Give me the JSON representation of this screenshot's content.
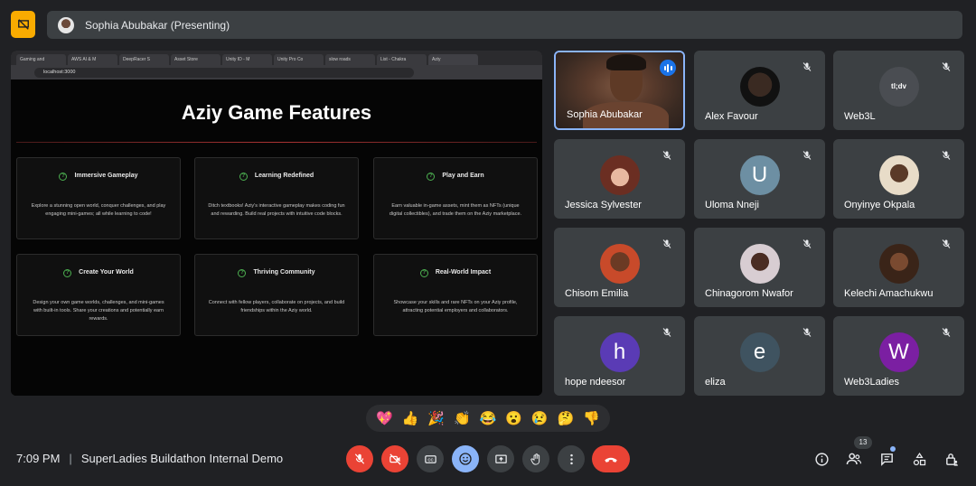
{
  "topbar": {
    "presenting_label": "Sophia Abubakar (Presenting)"
  },
  "shared_screen": {
    "browser_tabs": [
      "Gaming and",
      "AWS AI & M",
      "DeepRacer S",
      "Asset Store",
      "Unity ID - M",
      "Unity Pro Co",
      "slow roads",
      "List - Chakra",
      "Aziy"
    ],
    "url": "localhost:3000",
    "page_title": "Aziy Game Features",
    "cards": [
      {
        "title": "Immersive Gameplay",
        "desc": "Explore a stunning open world, conquer challenges, and play engaging mini-games; all while learning to code!"
      },
      {
        "title": "Learning Redefined",
        "desc": "Ditch textbooks! Aziy's interactive gameplay makes coding fun and rewarding. Build real projects with intuitive code blocks."
      },
      {
        "title": "Play and Earn",
        "desc": "Earn valuable in-game assets, mint them as NFTs (unique digital collectibles), and trade them on the Aziy marketplace."
      },
      {
        "title": "Create Your World",
        "desc": "Design your own game worlds, challenges, and mini-games with built-in tools. Share your creations and potentially earn rewards."
      },
      {
        "title": "Thriving Community",
        "desc": "Connect with fellow players, collaborate on projects, and build friendships within the Aziy world."
      },
      {
        "title": "Real-World Impact",
        "desc": "Showcase your skills and rare NFTs on your Aziy profile, attracting potential employers and collaborators."
      }
    ]
  },
  "participants": [
    {
      "name": "Sophia Abubakar",
      "type": "video",
      "speaking": true
    },
    {
      "name": "Alex Favour",
      "type": "photo",
      "color": "#1a1a1a"
    },
    {
      "name": "Web3L",
      "type": "logo",
      "logo_text": "tl;dv"
    },
    {
      "name": "Jessica Sylvester",
      "type": "photo",
      "color": "#8a4b3a"
    },
    {
      "name": "Uloma Nneji",
      "type": "letter",
      "letter": "U",
      "color": "#6d8fa3"
    },
    {
      "name": "Onyinye Okpala",
      "type": "photo",
      "color": "#e8dcc8"
    },
    {
      "name": "Chisom Emilia",
      "type": "photo",
      "color": "#c84a2a"
    },
    {
      "name": "Chinagorom Nwafor",
      "type": "photo",
      "color": "#d8cdd2"
    },
    {
      "name": "Kelechi Amachukwu",
      "type": "photo",
      "color": "#3a2418"
    },
    {
      "name": "hope ndeesor",
      "type": "letter",
      "letter": "h",
      "color": "#5a3bb5"
    },
    {
      "name": "eliza",
      "type": "letter",
      "letter": "e",
      "color": "#3f5360"
    },
    {
      "name": "Web3Ladies",
      "type": "letter",
      "letter": "W",
      "color": "#7b1fa2"
    }
  ],
  "reactions": [
    "💖",
    "👍",
    "🎉",
    "👏",
    "😂",
    "😮",
    "😢",
    "🤔",
    "👎"
  ],
  "footer": {
    "time": "7:09 PM",
    "separator": "|",
    "meeting_title": "SuperLadies Buildathon Internal Demo",
    "participant_count": "13"
  },
  "colors": {
    "accent_blue": "#8ab4f8",
    "danger_red": "#ea4335",
    "bg": "#202124",
    "tile_bg": "#3c4043"
  }
}
